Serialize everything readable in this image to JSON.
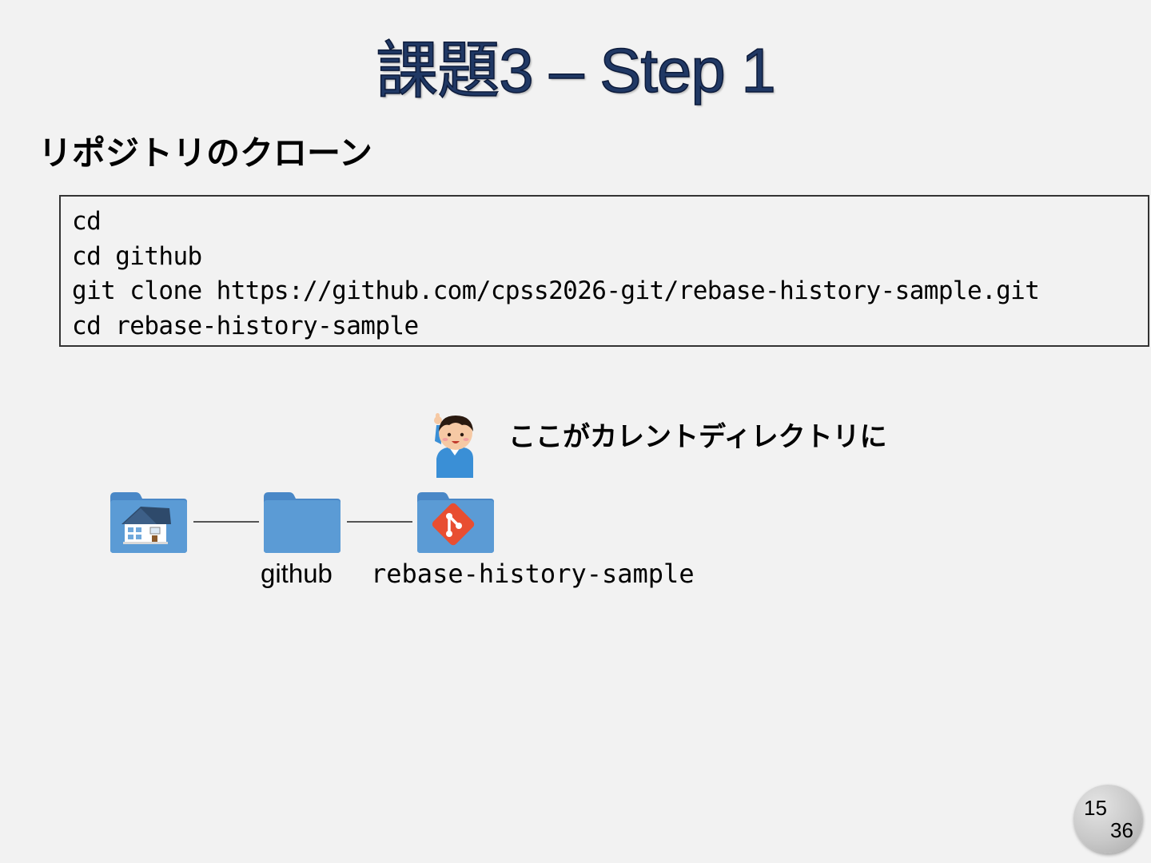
{
  "slide": {
    "title": "課題3 – Step 1",
    "subheading": "リポジトリのクローン"
  },
  "code": {
    "lines": [
      "cd",
      "cd github",
      "git clone https://github.com/cpss2026-git/rebase-history-sample.git",
      "cd rebase-history-sample"
    ]
  },
  "diagram": {
    "callout": "ここがカレントディレクトリに",
    "folders": [
      {
        "icon": "home-folder-icon",
        "label": ""
      },
      {
        "icon": "folder-icon",
        "label": "github"
      },
      {
        "icon": "git-folder-icon",
        "label": "rebase-history-sample"
      }
    ],
    "colors": {
      "folder": "#5b9bd5",
      "git_logo": "#e84e31"
    }
  },
  "page_number": {
    "current": "15",
    "total": "36"
  }
}
